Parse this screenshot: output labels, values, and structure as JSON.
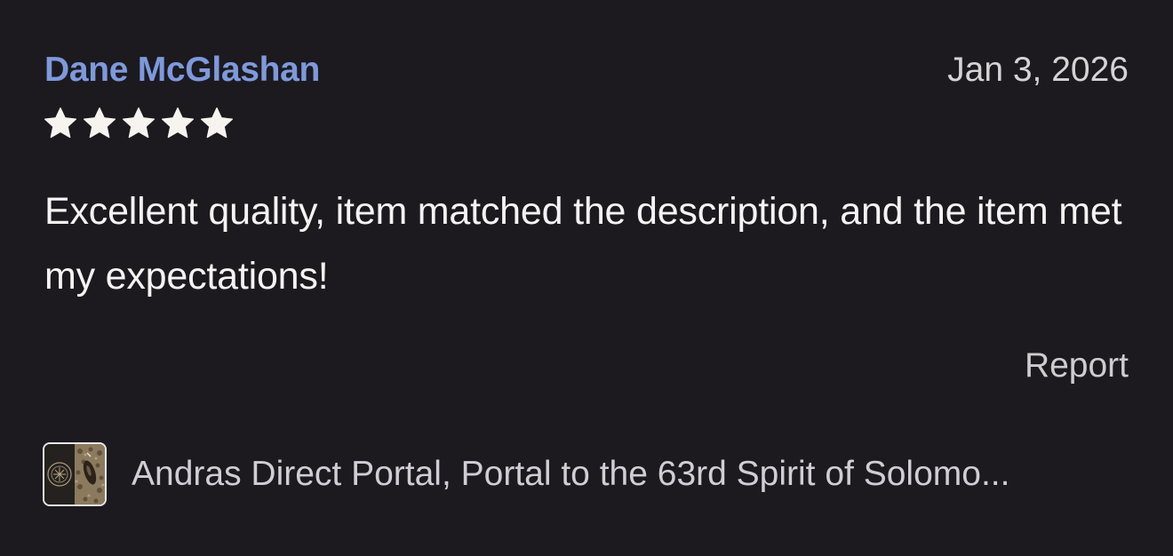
{
  "review": {
    "reviewer_name": "Dane McGlashan",
    "date": "Jan 3, 2026",
    "rating": 5,
    "rating_max": 5,
    "text": "Excellent quality, item matched the description, and the item met my expectations!",
    "report_label": "Report"
  },
  "listing": {
    "title": "Andras Direct Portal, Portal to the 63rd Spirit of Solomo...",
    "thumbnail_icon": "listing-thumbnail"
  },
  "colors": {
    "background": "#1c1a1e",
    "reviewer_name": "#7e99dc",
    "star": "#f7f4ef",
    "muted_text": "#d2cdd4"
  }
}
